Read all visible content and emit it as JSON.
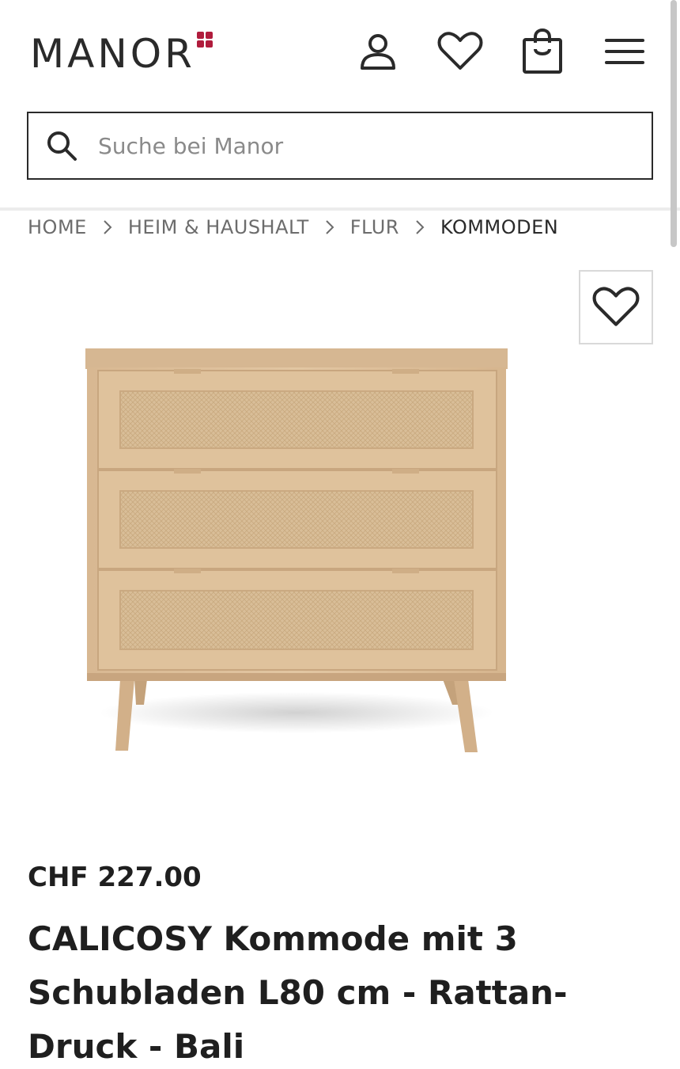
{
  "header": {
    "logo_text": "MANOR",
    "brand_color": "#b01c3c",
    "icons": [
      "user-icon",
      "heart-icon",
      "shopping-bag-icon",
      "menu-icon"
    ]
  },
  "search": {
    "placeholder": "Suche bei Manor",
    "value": ""
  },
  "breadcrumb": {
    "items": [
      "HOME",
      "HEIM & HAUSHALT",
      "FLUR",
      "KOMMODEN"
    ]
  },
  "product": {
    "price": "CHF 227.00",
    "title": "CALICOSY Kommode mit 3 Schubladen L80 cm - Rattan-Druck - Bali",
    "image_alt": "chest-of-drawers"
  }
}
